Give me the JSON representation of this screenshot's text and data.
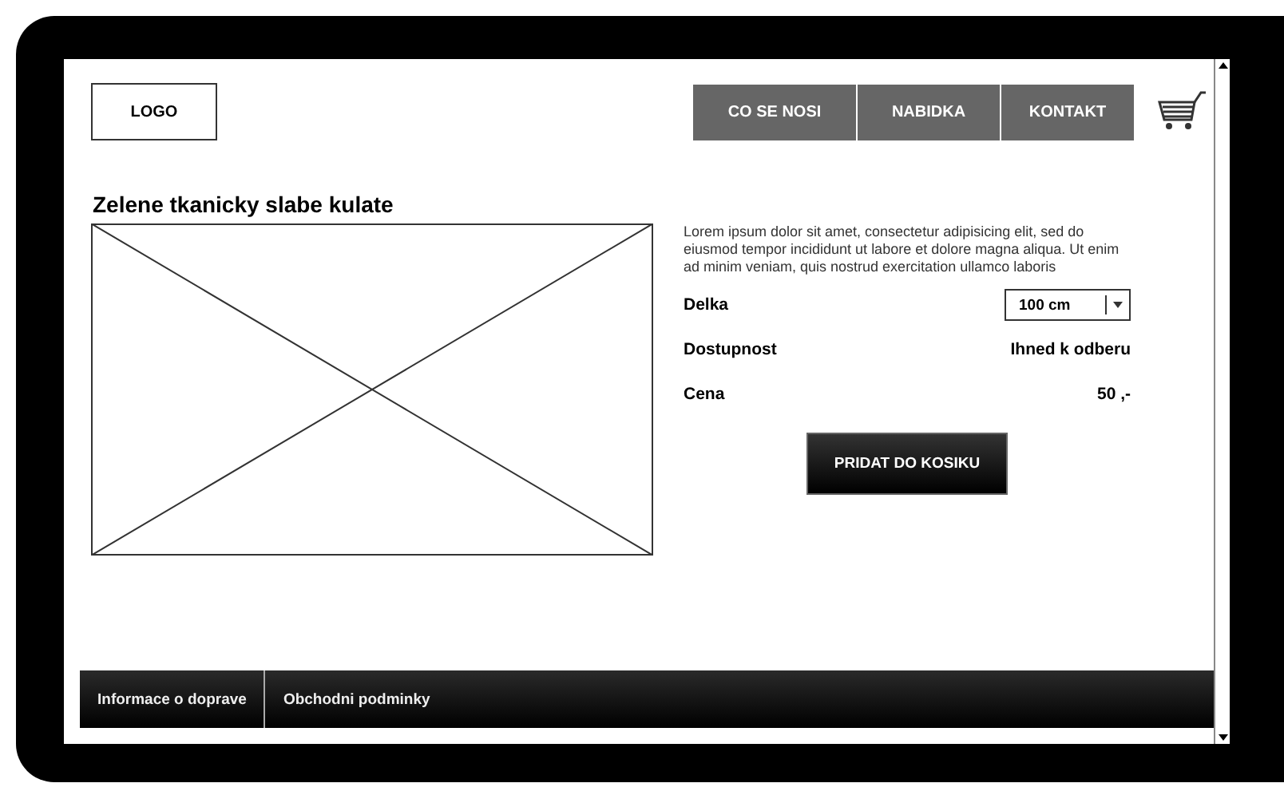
{
  "header": {
    "logo": "LOGO",
    "nav": [
      {
        "label": "CO SE NOSI"
      },
      {
        "label": "NABIDKA"
      },
      {
        "label": "KONTAKT"
      }
    ]
  },
  "product": {
    "title": "Zelene tkanicky slabe kulate",
    "image": {
      "kind": "placeholder"
    },
    "description": "Lorem ipsum dolor sit amet, consectetur adipisicing elit, sed do eiusmod tempor incididunt ut labore et dolore magna aliqua. Ut enim ad minim veniam, quis nostrud exercitation ullamco laboris",
    "attributes": [
      {
        "kind": "select",
        "label": "Delka",
        "value": "100 cm"
      },
      {
        "kind": "text",
        "label": "Dostupnost",
        "value": "Ihned k odberu"
      },
      {
        "kind": "text",
        "label": "Cena",
        "value": "50 ,-"
      }
    ],
    "button": "PRIDAT DO KOSIKU"
  },
  "footer": {
    "links": [
      "Informace o doprave",
      "Obchodni podminky"
    ]
  }
}
